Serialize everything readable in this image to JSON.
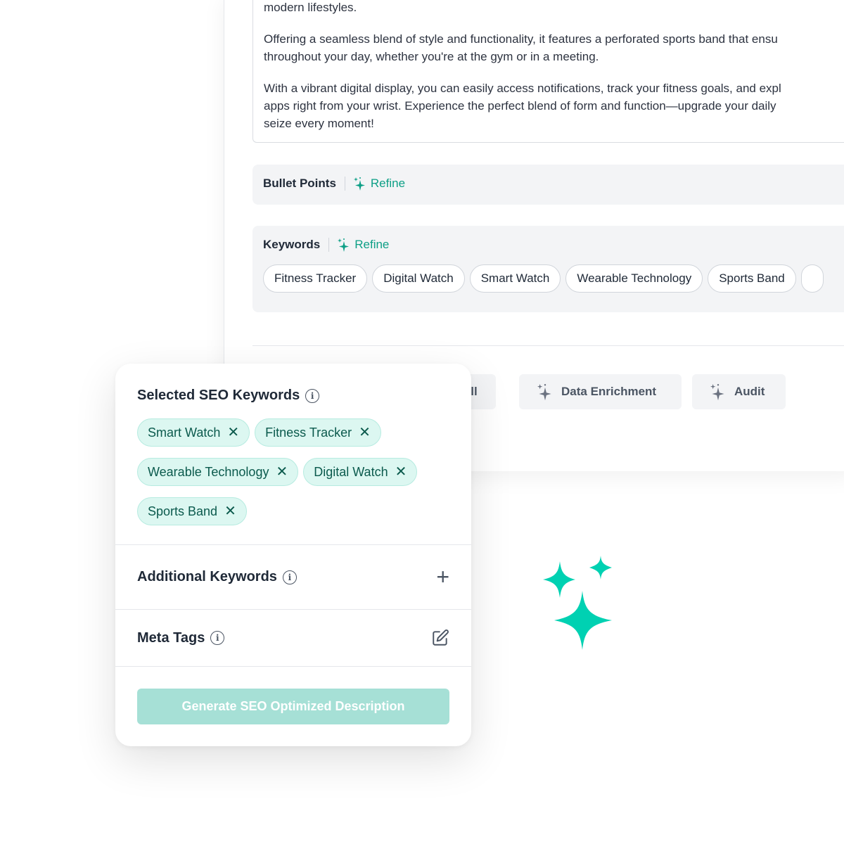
{
  "description": {
    "lines": [
      [
        "modern lifestyles."
      ],
      [
        "Offering a seamless blend of style and functionality, it features a perforated sports band that ensu",
        "throughout your day, whether you're at the gym or in a meeting."
      ],
      [
        "With a vibrant digital display, you can easily access notifications, track your fitness goals, and expl",
        "apps right from your wrist. Experience the perfect blend of form and function—upgrade your daily",
        "seize every moment!"
      ]
    ]
  },
  "bullet_points": {
    "title": "Bullet Points",
    "refine_label": "Refine"
  },
  "keywords": {
    "title": "Keywords",
    "refine_label": "Refine",
    "items": [
      "Fitness Tracker",
      "Digital Watch",
      "Smart Watch",
      "Wearable Technology",
      "Sports Band"
    ]
  },
  "actions": [
    {
      "label": "All",
      "icon": "sparkle-icon"
    },
    {
      "label": "Data Enrichment",
      "icon": "sparkle-icon"
    },
    {
      "label": "Audit",
      "icon": "sparkle-icon"
    }
  ],
  "seo_card": {
    "selected_title": "Selected SEO Keywords",
    "selected": [
      "Smart Watch",
      "Fitness Tracker",
      "Wearable Technology",
      "Digital Watch",
      "Sports Band"
    ],
    "additional_title": "Additional Keywords",
    "meta_title": "Meta Tags",
    "generate_label": "Generate SEO Optimized Description",
    "remove_glyph": "✕",
    "info_glyph": "i",
    "plus_glyph": "+"
  },
  "colors": {
    "accent": "#0d9f86",
    "tag_bg": "#dcf7f1",
    "button_disabled": "#a6e0d6",
    "sparkle": "#00d1b2"
  }
}
